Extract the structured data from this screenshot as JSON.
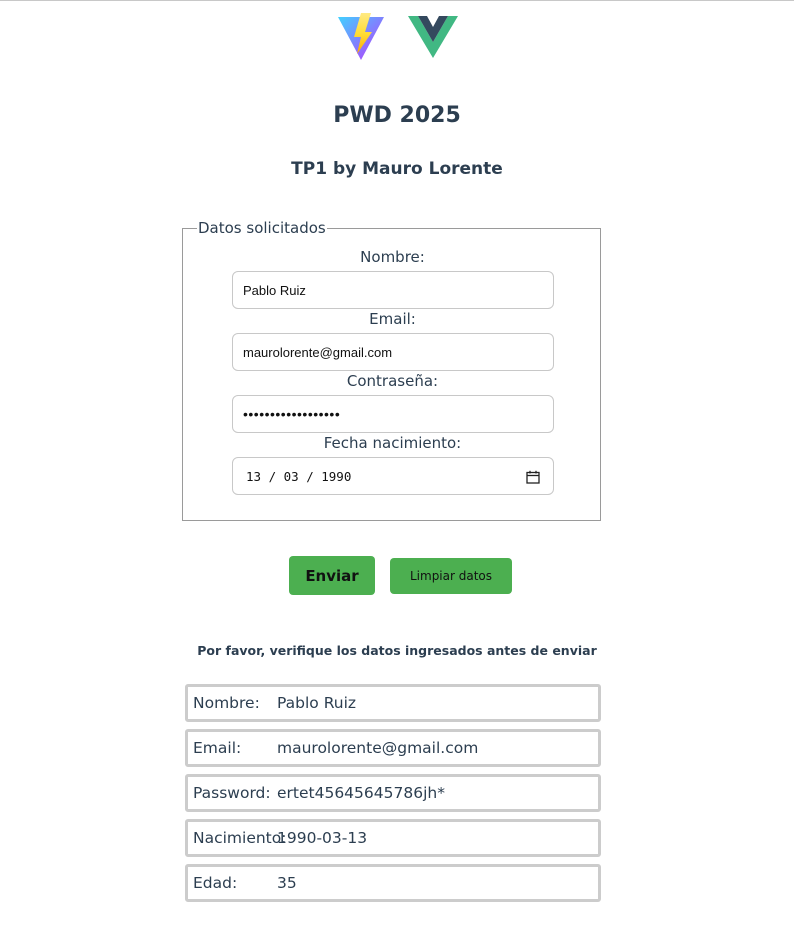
{
  "header": {
    "title": "PWD 2025",
    "subtitle": "TP1 by Mauro Lorente"
  },
  "form": {
    "legend": "Datos solicitados",
    "nombre_label": "Nombre:",
    "nombre_value": "Pablo Ruiz",
    "email_label": "Email:",
    "email_value": "maurolorente@gmail.com",
    "password_label": "Contraseña:",
    "password_masked": "••••••••••••••••••",
    "fecha_label": "Fecha nacimiento:",
    "fecha_value": "13 / 03 / 1990"
  },
  "buttons": {
    "send_label": "Enviar",
    "clear_label": "Limpiar datos"
  },
  "summary": {
    "verify_text": "Por favor, verifique los datos ingresados antes de enviar",
    "rows": [
      {
        "key": "Nombre:",
        "value": "Pablo Ruiz"
      },
      {
        "key": "Email:",
        "value": "maurolorente@gmail.com"
      },
      {
        "key": "Password:",
        "value": "ertet45645645786jh*"
      },
      {
        "key": "Nacimiento:",
        "value": "1990-03-13"
      },
      {
        "key": "Edad:",
        "value": "35"
      }
    ]
  },
  "colors": {
    "button_green": "#4caf50",
    "text_dark": "#2c3e50",
    "vue_green": "#41b883",
    "vue_dark": "#34495e"
  },
  "icons": [
    "vite-logo",
    "vue-logo",
    "calendar-icon"
  ]
}
